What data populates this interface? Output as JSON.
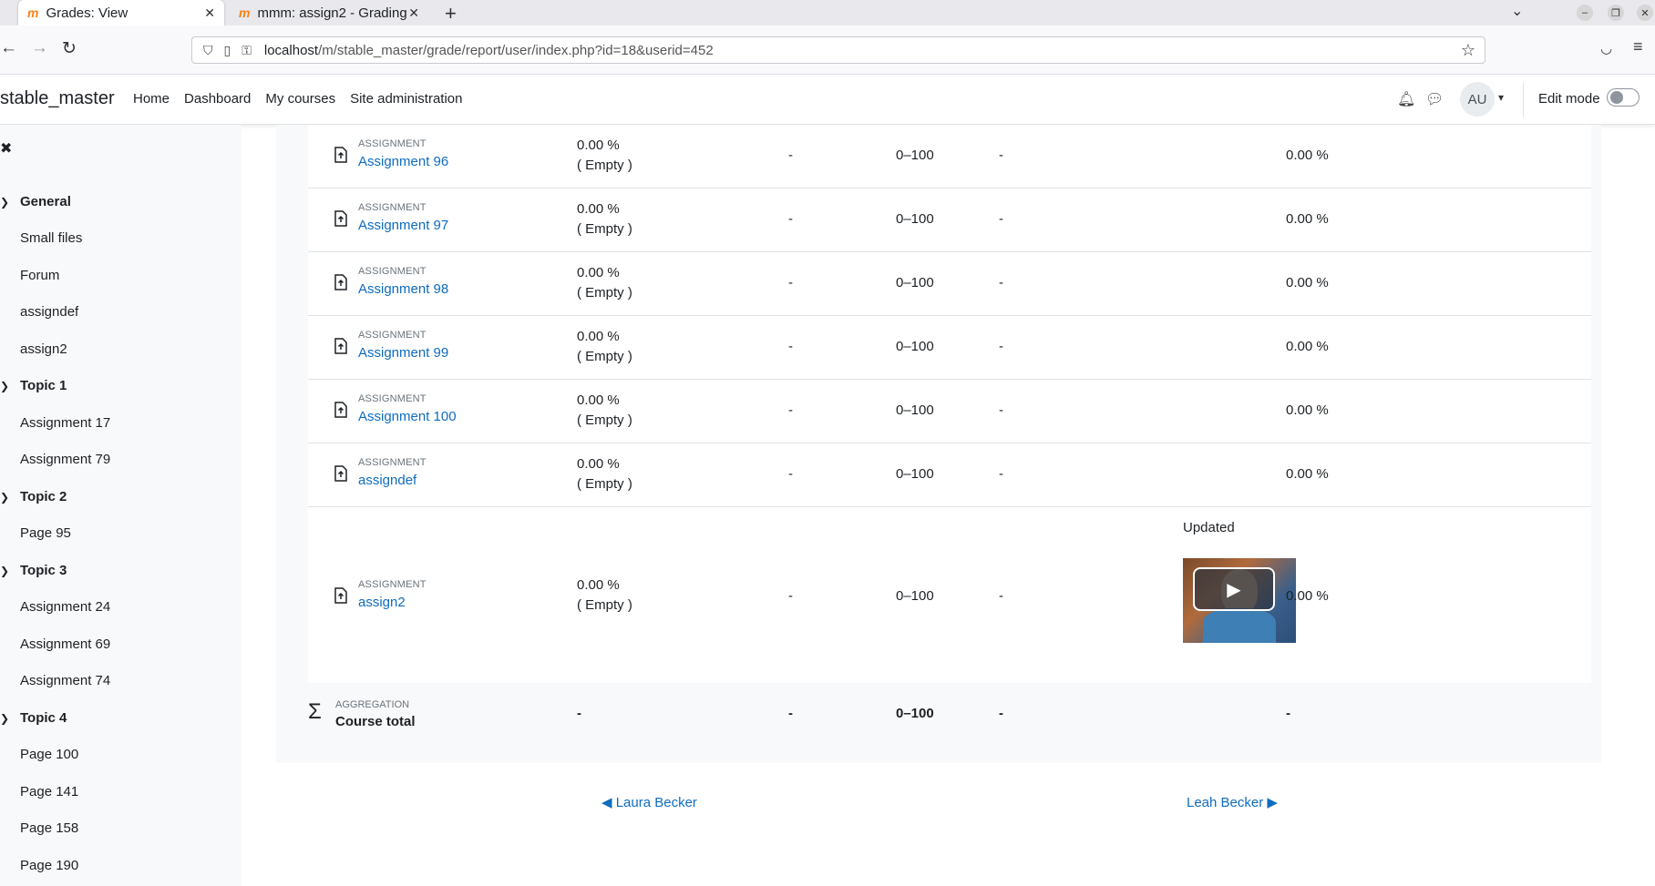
{
  "browser": {
    "tabs": [
      {
        "title": "Grades: View",
        "active": true
      },
      {
        "title": "mmm: assign2 - Grading",
        "active": false
      }
    ],
    "url_host": "localhost",
    "url_path": "/m/stable_master/grade/report/user/index.php?id=18&userid=452"
  },
  "navbar": {
    "brand": "stable_master",
    "items": [
      "Home",
      "Dashboard",
      "My courses",
      "Site administration"
    ],
    "avatar_initials": "AU",
    "edit_mode_label": "Edit mode"
  },
  "course_index": {
    "sections": [
      {
        "title": "General",
        "items": [
          "Small files",
          "Forum",
          "assigndef",
          "assign2"
        ]
      },
      {
        "title": "Topic 1",
        "items": [
          "Assignment 17",
          "Assignment 79"
        ]
      },
      {
        "title": "Topic 2",
        "items": [
          "Page 95"
        ]
      },
      {
        "title": "Topic 3",
        "items": [
          "Assignment 24",
          "Assignment 69",
          "Assignment 74"
        ]
      },
      {
        "title": "Topic 4",
        "items": [
          "Page 100",
          "Page 141",
          "Page 158",
          "Page 190"
        ]
      }
    ]
  },
  "grade_rows": [
    {
      "type": "ASSIGNMENT",
      "name": "Assignment 96",
      "grade": "0.00 %",
      "grade_status": "( Empty )",
      "col2": "-",
      "range": "0–100",
      "col4": "-",
      "contribution": "0.00 %"
    },
    {
      "type": "ASSIGNMENT",
      "name": "Assignment 97",
      "grade": "0.00 %",
      "grade_status": "( Empty )",
      "col2": "-",
      "range": "0–100",
      "col4": "-",
      "contribution": "0.00 %"
    },
    {
      "type": "ASSIGNMENT",
      "name": "Assignment 98",
      "grade": "0.00 %",
      "grade_status": "( Empty )",
      "col2": "-",
      "range": "0–100",
      "col4": "-",
      "contribution": "0.00 %"
    },
    {
      "type": "ASSIGNMENT",
      "name": "Assignment 99",
      "grade": "0.00 %",
      "grade_status": "( Empty )",
      "col2": "-",
      "range": "0–100",
      "col4": "-",
      "contribution": "0.00 %"
    },
    {
      "type": "ASSIGNMENT",
      "name": "Assignment 100",
      "grade": "0.00 %",
      "grade_status": "( Empty )",
      "col2": "-",
      "range": "0–100",
      "col4": "-",
      "contribution": "0.00 %"
    },
    {
      "type": "ASSIGNMENT",
      "name": "assigndef",
      "grade": "0.00 %",
      "grade_status": "( Empty )",
      "col2": "-",
      "range": "0–100",
      "col4": "-",
      "contribution": "0.00 %"
    },
    {
      "type": "ASSIGNMENT",
      "name": "assign2",
      "grade": "0.00 %",
      "grade_status": "( Empty )",
      "col2": "-",
      "range": "0–100",
      "col4": "-",
      "feedback": "Updated",
      "contribution": "0.00 %"
    }
  ],
  "course_total": {
    "type": "AGGREGATION",
    "name": "Course total",
    "grade": "-",
    "col2": "-",
    "range": "0–100",
    "col4": "-",
    "contribution": "-"
  },
  "pager": {
    "prev_label": "Laura Becker",
    "next_label": "Leah Becker"
  },
  "colors": {
    "link": "#0f6cbf",
    "drawer_bg": "#f8f9fa"
  }
}
